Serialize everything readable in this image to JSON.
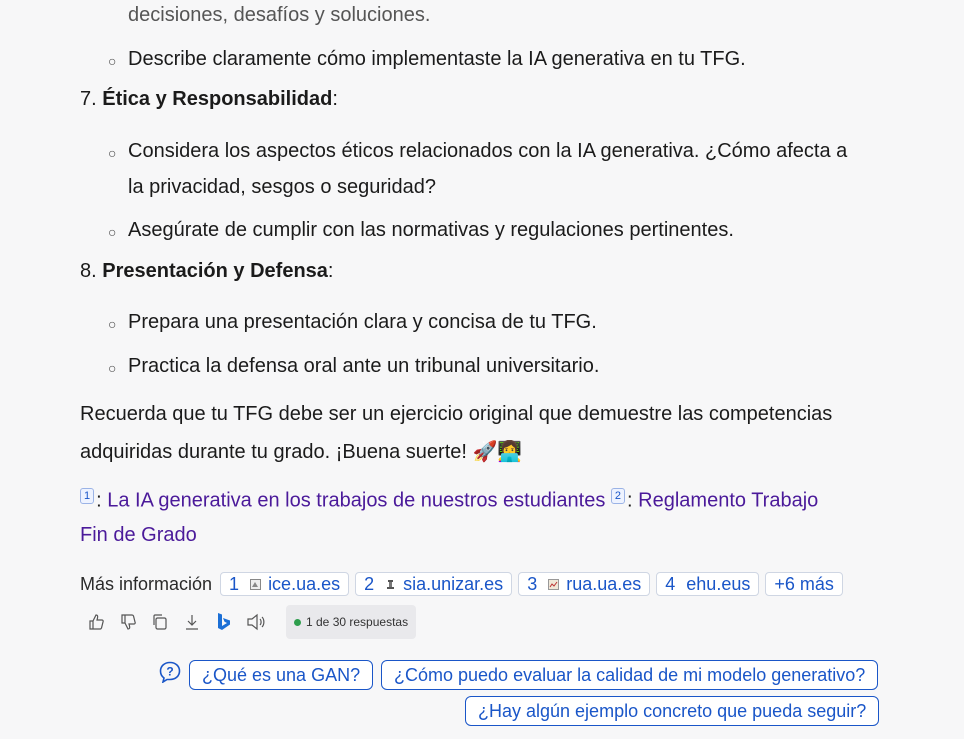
{
  "content": {
    "line0": "decisiones, desafíos y soluciones.",
    "line1": "Describe claramente cómo implementaste la IA generativa en tu TFG.",
    "item7_num": "7.",
    "item7_title": "Ética y Responsabilidad",
    "item7_colon": ":",
    "item7_b1_l1": "Considera los aspectos éticos relacionados con la IA generativa. ¿Cómo afecta a",
    "item7_b1_l2": "la privacidad, sesgos o seguridad?",
    "item7_b2": "Asegúrate de cumplir con las normativas y regulaciones pertinentes.",
    "item8_num": "8.",
    "item8_title": "Presentación y Defensa",
    "item8_colon": ":",
    "item8_b1": "Prepara una presentación clara y concisa de tu TFG.",
    "item8_b2": "Practica la defensa oral ante un tribunal universitario.",
    "closing_l1": "Recuerda que tu TFG debe ser un ejercicio original que demuestre las competencias",
    "closing_l2": "adquiridas durante tu grado. ¡Buena suerte! 🚀👩‍💻"
  },
  "citations": {
    "c1_num": "1",
    "c1_sep": ": ",
    "c1_text": "La IA generativa en los trabajos de nuestros estudiantes",
    "c2_num": "2",
    "c2_sep": ": ",
    "c2_text_l1": "Reglamento Trabajo",
    "c2_text_l2": "Fin de Grado"
  },
  "more_info": {
    "label": "Más información",
    "sources": [
      {
        "num": "1",
        "domain": "ice.ua.es"
      },
      {
        "num": "2",
        "domain": "sia.unizar.es"
      },
      {
        "num": "3",
        "domain": "rua.ua.es"
      },
      {
        "num": "4",
        "domain": "ehu.eus"
      }
    ],
    "more": "+6 más"
  },
  "actions": {
    "icons": [
      "thumbs-up-icon",
      "thumbs-down-icon",
      "copy-icon",
      "download-icon",
      "bing-icon",
      "speaker-icon"
    ],
    "counter": "1 de 30 respuestas",
    "counter_dot_color": "#2e9e4d"
  },
  "suggestions": [
    "¿Qué es una GAN?",
    "¿Cómo puedo evaluar la calidad de mi modelo generativo?",
    "¿Hay algún ejemplo concreto que pueda seguir?"
  ],
  "colors": {
    "link": "#4b1a9a",
    "accent": "#1a56c8",
    "background": "#f7f7f8"
  }
}
